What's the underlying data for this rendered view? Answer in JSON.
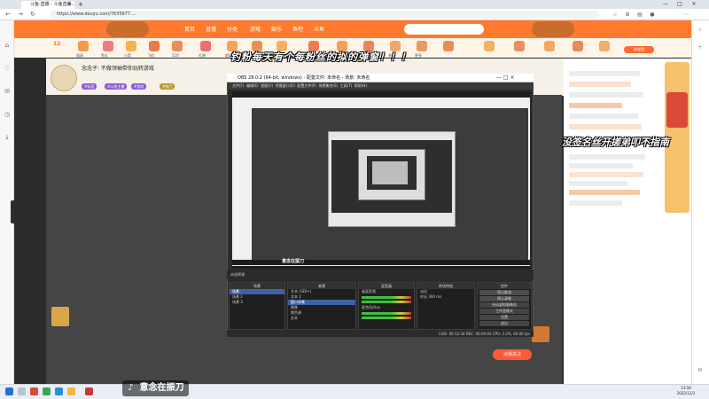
{
  "browser": {
    "tab_title": "斗鱼·直播 - 斗鱼直播...",
    "tab_close": "×",
    "new_tab": "+",
    "url": "https://www.douyu.com/7635977....",
    "window_controls": [
      "—",
      "□",
      "×"
    ],
    "nav": [
      "←",
      "→",
      "↻"
    ]
  },
  "site": {
    "nav_items": [
      "首页",
      "直播",
      "分类",
      "游戏",
      "娱乐",
      "鱼吧",
      "斗鱼"
    ],
    "streamer_title": "念念子: 不做领袖带你玩转游戏",
    "fans_button": "粉丝团",
    "follow_button": "点我关注",
    "tags": [
      "#标签",
      "#斗鱼主播",
      "#游戏",
      "#热门"
    ],
    "gift_labels": [
      "道具",
      "鱼丸",
      "火箭",
      "飞机",
      "520",
      "礼物",
      "超级",
      "办卡",
      "福袋",
      "幸运",
      "抽奖",
      "粉丝",
      "贵族",
      "更多"
    ],
    "fans_count": "12"
  },
  "obs": {
    "title": "OBS 28.0.2 (64-bit, windows) - 配置文件: 未命名 - 场景: 未命名",
    "menu": [
      "文件(F)",
      "编辑(E)",
      "视图(V)",
      "停靠窗口(D)",
      "配置文件(P)",
      "场景集合(S)",
      "工具(T)",
      "帮助(H)"
    ],
    "title_buttons": "—  □  ×",
    "top_strip": "未选择源",
    "docks": {
      "scenes": {
        "title": "场景",
        "items": [
          "场景",
          "场景 2",
          "场景 3"
        ]
      },
      "sources": {
        "title": "来源",
        "items": [
          "文本 (GDI+)",
          "文本 2",
          "窗口采集",
          "图像",
          "颜色源",
          "文本"
        ]
      },
      "mixer": {
        "title": "混音器",
        "items": [
          "桌面音频",
          "麦克风/Aux"
        ]
      },
      "transitions": {
        "title": "转场特效",
        "items": [
          "淡出",
          "时长 300 ms"
        ]
      },
      "controls": {
        "title": "控件",
        "items": [
          "停止推流",
          "停止录制",
          "启动虚拟摄像机",
          "工作室模式",
          "设置",
          "退出"
        ]
      }
    },
    "status": "LIVE: 00:12:34   REC: 00:00:00   CPU: 3.2%, 60.00 fps",
    "inner_tiktok": "意念在振刀"
  },
  "overlays": {
    "line1": "钓粉每天有个每粉丝的拟的弹窗！！！",
    "line2": "没签名丝开搓弟叩不指南"
  },
  "watermark": {
    "logo": "♪",
    "text": "意念在振刀"
  },
  "taskbar": {
    "clock_time": "13:58",
    "clock_date": "2022/11/2"
  },
  "colors": {
    "douyu_orange": "#ff7a2f",
    "obs_dark": "#2b2b2b",
    "tag_purple": "#8d5bd6"
  }
}
